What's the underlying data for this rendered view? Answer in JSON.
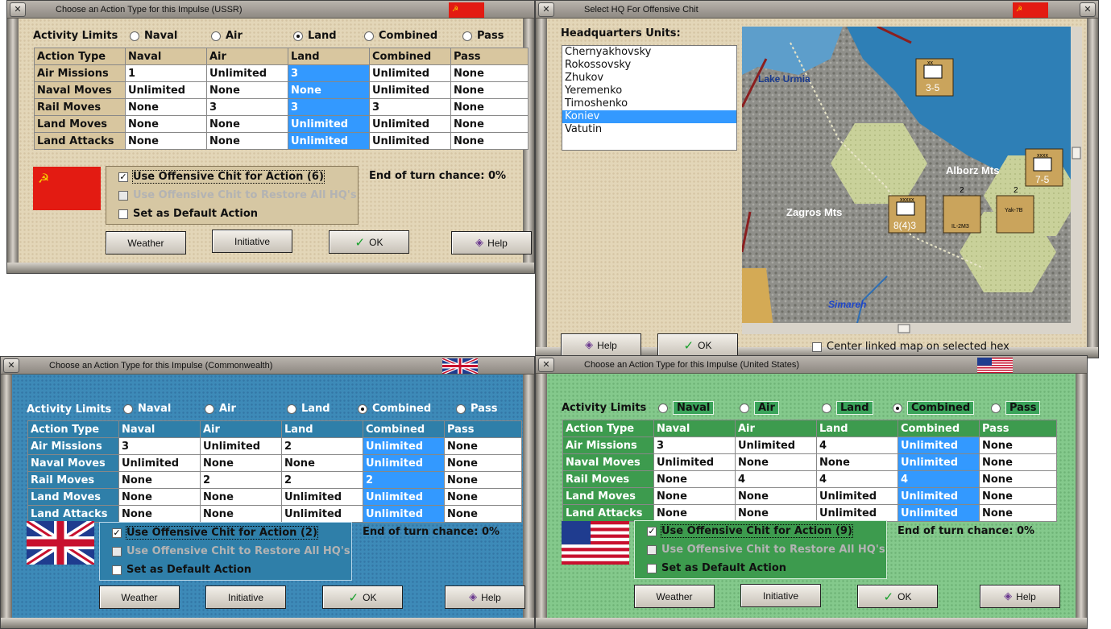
{
  "ussr": {
    "title": "Choose an Action Type for this Impulse (USSR)",
    "activity_label": "Activity Limits",
    "radios": [
      {
        "label": "Naval",
        "checked": false
      },
      {
        "label": "Air",
        "checked": false
      },
      {
        "label": "Land",
        "checked": true
      },
      {
        "label": "Combined",
        "checked": false
      },
      {
        "label": "Pass",
        "checked": false
      }
    ],
    "headers": [
      "Action Type",
      "Naval",
      "Air",
      "Land",
      "Combined",
      "Pass"
    ],
    "rows": [
      [
        "Air Missions",
        "1",
        "Unlimited",
        "3",
        "Unlimited",
        "None"
      ],
      [
        "Naval Moves",
        "Unlimited",
        "None",
        "None",
        "Unlimited",
        "None"
      ],
      [
        "Rail Moves",
        "None",
        "3",
        "3",
        "3",
        "None"
      ],
      [
        "Land Moves",
        "None",
        "None",
        "Unlimited",
        "Unlimited",
        "None"
      ],
      [
        "Land Attacks",
        "None",
        "None",
        "Unlimited",
        "Unlimited",
        "None"
      ]
    ],
    "cb_offensive": "Use Offensive Chit for Action (6)",
    "cb_restore": "Use Offensive Chit to Restore All HQ's",
    "cb_default": "Set as Default Action",
    "end_turn": "End of turn chance: 0%",
    "btn_weather": "Weather",
    "btn_initiative": "Initiative",
    "btn_ok": "OK",
    "btn_help": "Help"
  },
  "hq": {
    "title": "Select HQ For Offensive Chit",
    "list_label": "Headquarters Units:",
    "units": [
      "Chernyakhovsky",
      "Rokossovsky",
      "Zhukov",
      "Yeremenko",
      "Timoshenko",
      "Koniev",
      "Vatutin"
    ],
    "selected": "Koniev",
    "map_labels": {
      "lake": "Lake Urmia",
      "mts1": "Alborz Mts",
      "mts2": "Zagros Mts",
      "city": "Simareh"
    },
    "counters": [
      {
        "top": "xx",
        "bottom": "3-5"
      },
      {
        "top": "xxxx",
        "bottom": "7-5"
      },
      {
        "top": "xxxxx",
        "bottom": "8(4)3"
      },
      {
        "top": "2",
        "bottom": "IL-2M3"
      },
      {
        "top": "2",
        "bottom": "Yak-7B"
      }
    ],
    "center_label": "Center linked map on selected hex",
    "btn_help": "Help",
    "btn_ok": "OK"
  },
  "cw": {
    "title": "Choose an Action Type for this Impulse (Commonwealth)",
    "activity_label": "Activity Limits",
    "radios": [
      {
        "label": "Naval",
        "checked": false
      },
      {
        "label": "Air",
        "checked": false
      },
      {
        "label": "Land",
        "checked": false
      },
      {
        "label": "Combined",
        "checked": true
      },
      {
        "label": "Pass",
        "checked": false
      }
    ],
    "headers": [
      "Action Type",
      "Naval",
      "Air",
      "Land",
      "Combined",
      "Pass"
    ],
    "rows": [
      [
        "Air Missions",
        "3",
        "Unlimited",
        "2",
        "Unlimited",
        "None"
      ],
      [
        "Naval Moves",
        "Unlimited",
        "None",
        "None",
        "Unlimited",
        "None"
      ],
      [
        "Rail Moves",
        "None",
        "2",
        "2",
        "2",
        "None"
      ],
      [
        "Land Moves",
        "None",
        "None",
        "Unlimited",
        "Unlimited",
        "None"
      ],
      [
        "Land Attacks",
        "None",
        "None",
        "Unlimited",
        "Unlimited",
        "None"
      ]
    ],
    "cb_offensive": "Use Offensive Chit for Action (2)",
    "cb_restore": "Use Offensive Chit to Restore All HQ's",
    "cb_default": "Set as Default Action",
    "end_turn": "End of turn chance: 0%",
    "btn_weather": "Weather",
    "btn_initiative": "Initiative",
    "btn_ok": "OK",
    "btn_help": "Help"
  },
  "us": {
    "title": "Choose an Action Type for this Impulse (United States)",
    "activity_label": "Activity Limits",
    "radios": [
      {
        "label": "Naval",
        "checked": false
      },
      {
        "label": "Air",
        "checked": false
      },
      {
        "label": "Land",
        "checked": false
      },
      {
        "label": "Combined",
        "checked": true
      },
      {
        "label": "Pass",
        "checked": false
      }
    ],
    "headers": [
      "Action Type",
      "Naval",
      "Air",
      "Land",
      "Combined",
      "Pass"
    ],
    "rows": [
      [
        "Air Missions",
        "3",
        "Unlimited",
        "4",
        "Unlimited",
        "None"
      ],
      [
        "Naval Moves",
        "Unlimited",
        "None",
        "None",
        "Unlimited",
        "None"
      ],
      [
        "Rail Moves",
        "None",
        "4",
        "4",
        "4",
        "None"
      ],
      [
        "Land Moves",
        "None",
        "None",
        "Unlimited",
        "Unlimited",
        "None"
      ],
      [
        "Land Attacks",
        "None",
        "None",
        "Unlimited",
        "Unlimited",
        "None"
      ]
    ],
    "cb_offensive": "Use Offensive Chit for Action (9)",
    "cb_restore": "Use Offensive Chit to Restore All HQ's",
    "cb_default": "Set as Default Action",
    "end_turn": "End of turn chance: 0%",
    "btn_weather": "Weather",
    "btn_initiative": "Initiative",
    "btn_ok": "OK",
    "btn_help": "Help"
  },
  "colors": {
    "selected": "#3399ff",
    "ussr_red": "#e31b12",
    "uk_blue": "#1f3c8f",
    "us_red": "#c8102e"
  }
}
